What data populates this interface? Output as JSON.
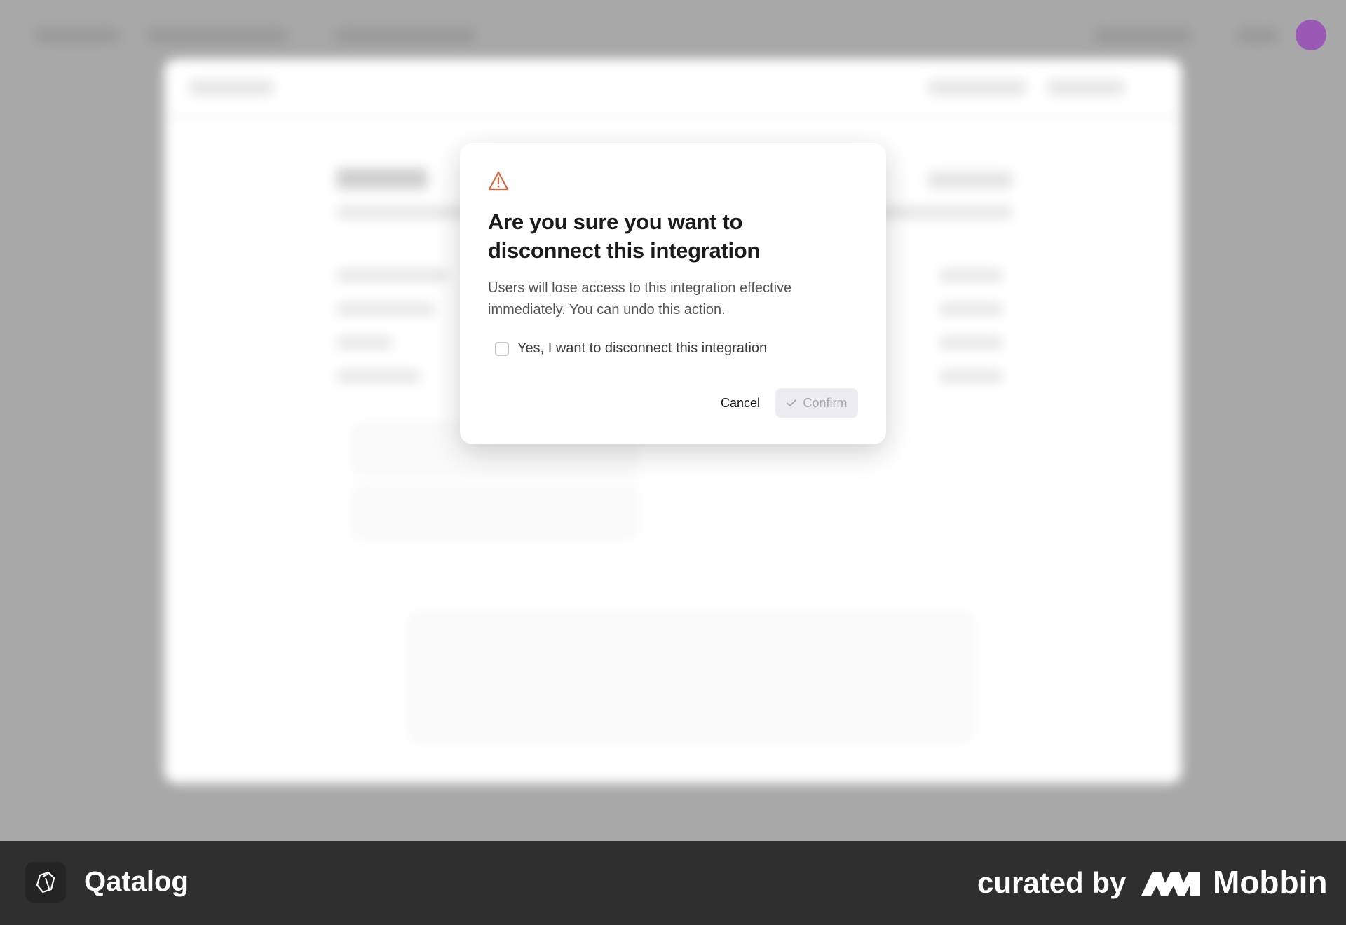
{
  "dialog": {
    "title": "Are you sure you want to disconnect this integration",
    "description": "Users will lose access to this integration effective immediately. You can undo this action.",
    "checkbox_label": "Yes, I want to disconnect this integration",
    "checkbox_checked": false,
    "cancel_label": "Cancel",
    "confirm_label": "Confirm",
    "confirm_enabled": false,
    "warning_icon": "warning-triangle-icon",
    "warning_color": "#d9623b"
  },
  "footer": {
    "app_name": "Qatalog",
    "curated_by": "curated by",
    "brand": "Mobbin"
  },
  "colors": {
    "confirm_disabled_bg": "#ececf2",
    "confirm_disabled_text": "#a6a6ae",
    "footer_bg": "#2f2f2f",
    "avatar": "#9b59b6"
  }
}
